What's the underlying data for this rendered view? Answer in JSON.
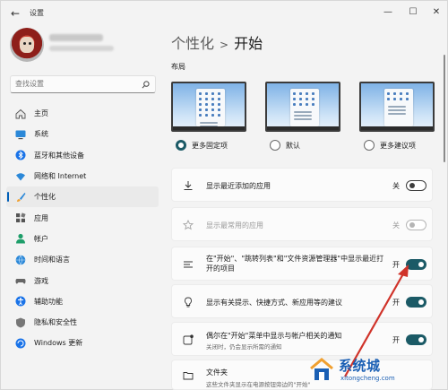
{
  "window": {
    "title": "设置",
    "back_glyph": "←",
    "controls": {
      "minimize": "—",
      "maximize": "☐",
      "close": "✕"
    }
  },
  "sidebar": {
    "search_placeholder": "查找设置",
    "items": [
      {
        "label": "主页",
        "icon": "home-icon"
      },
      {
        "label": "系统",
        "icon": "system-icon"
      },
      {
        "label": "蓝牙和其他设备",
        "icon": "bluetooth-icon"
      },
      {
        "label": "网络和 Internet",
        "icon": "wifi-icon"
      },
      {
        "label": "个性化",
        "icon": "brush-icon",
        "active": true
      },
      {
        "label": "应用",
        "icon": "apps-icon"
      },
      {
        "label": "帐户",
        "icon": "account-icon"
      },
      {
        "label": "时间和语言",
        "icon": "globe-clock-icon"
      },
      {
        "label": "游戏",
        "icon": "gamepad-icon"
      },
      {
        "label": "辅助功能",
        "icon": "accessibility-icon"
      },
      {
        "label": "隐私和安全性",
        "icon": "shield-icon"
      },
      {
        "label": "Windows 更新",
        "icon": "update-icon"
      }
    ]
  },
  "main": {
    "breadcrumb": {
      "parent": "个性化",
      "separator": ">",
      "current": "开始"
    },
    "layout": {
      "heading": "布局",
      "options": [
        {
          "label": "更多固定项",
          "selected": true
        },
        {
          "label": "默认",
          "selected": false
        },
        {
          "label": "更多建议项",
          "selected": false
        }
      ]
    },
    "settings": [
      {
        "text": "显示最近添加的应用",
        "subtext": "",
        "state": "关",
        "on": false,
        "disabled": false,
        "icon": "download-icon"
      },
      {
        "text": "显示最常用的应用",
        "subtext": "",
        "state": "关",
        "on": false,
        "disabled": true,
        "icon": "star-icon"
      },
      {
        "text1": "在\"开始\"、\"跳转列表\"和\"文件资源管理器\"中显示最近打",
        "text2": "开的项目",
        "state": "开",
        "on": true,
        "disabled": false,
        "icon": "list-icon"
      },
      {
        "text": "显示有关提示、快捷方式、新应用等的建议",
        "subtext": "",
        "state": "开",
        "on": true,
        "disabled": false,
        "icon": "lightbulb-icon"
      },
      {
        "text": "偶尔在\"开始\"菜单中显示与帐户相关的通知",
        "subtext": "关闭时，仍会显示所需的通知",
        "state": "开",
        "on": true,
        "disabled": false,
        "icon": "notification-icon"
      },
      {
        "text": "文件夹",
        "subtext": "这些文件夹显示在电源按钮旁边的\"开始\"",
        "icon": "folder-icon"
      }
    ]
  },
  "watermark": {
    "text": "系统城",
    "url": "xitongcheng.com"
  },
  "colors": {
    "accent": "#1b5a66",
    "nav_indicator": "#005fb8",
    "arrow": "#d0332a"
  }
}
